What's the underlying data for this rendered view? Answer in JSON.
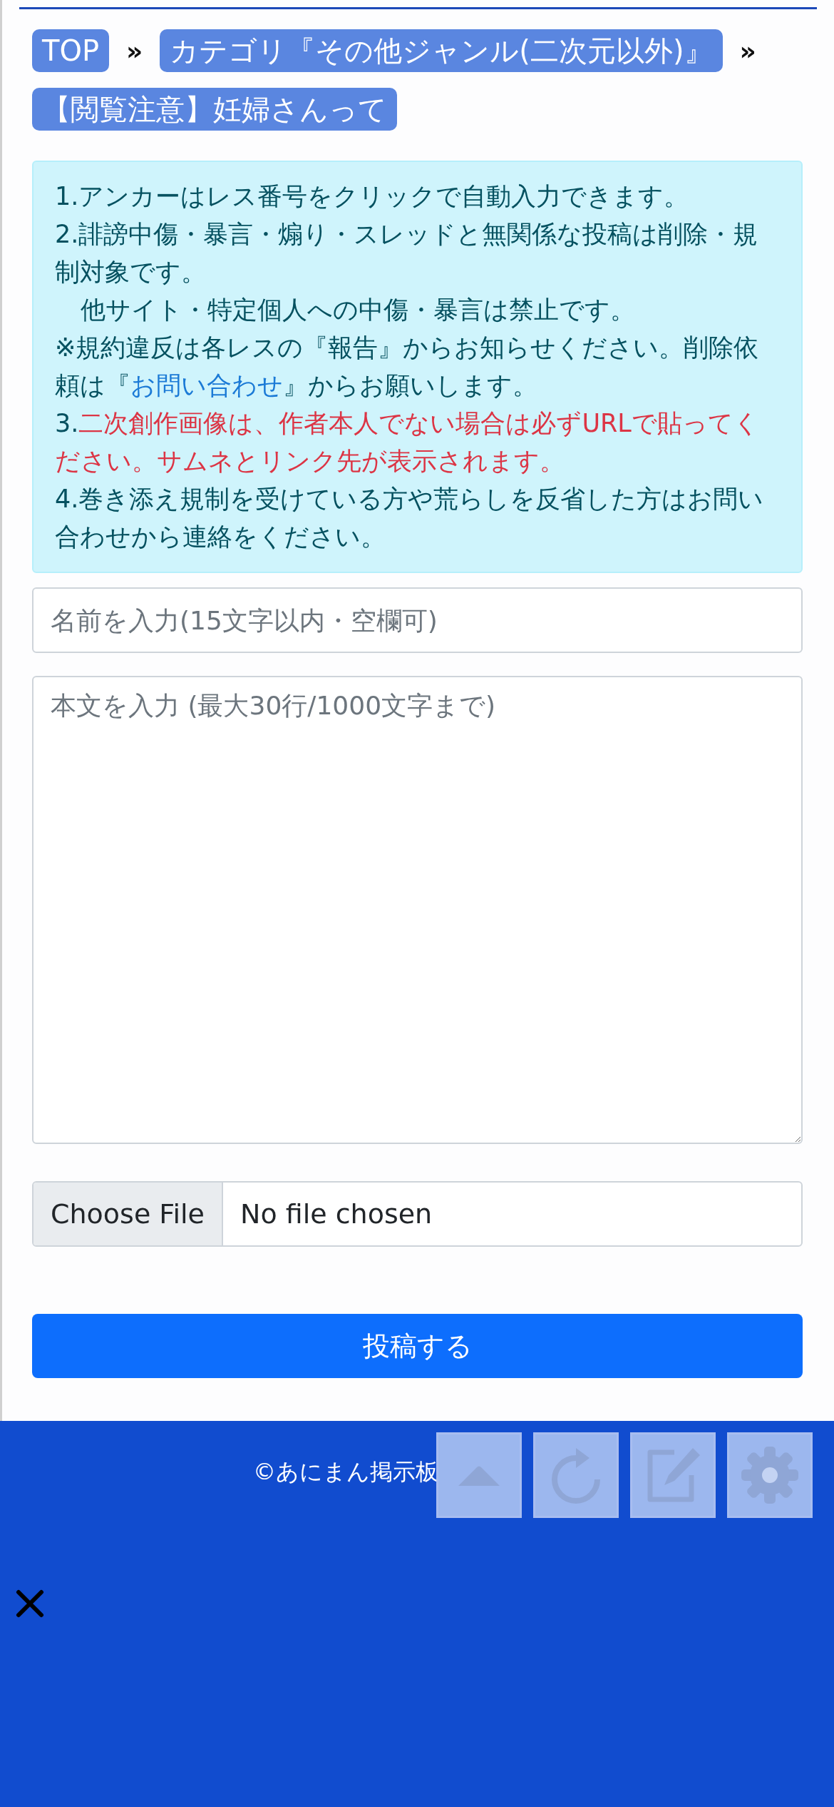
{
  "breadcrumbs": [
    {
      "kind": "link",
      "label": "TOP"
    },
    {
      "kind": "separator",
      "label": "»"
    },
    {
      "kind": "link",
      "label": "カテゴリ『その他ジャンル(二次元以外)』"
    },
    {
      "kind": "separator",
      "label": "»"
    },
    {
      "kind": "link",
      "label": "【閲覧注意】妊婦さんって"
    }
  ],
  "notice": [
    {
      "indent": false,
      "segments": [
        {
          "kind": "plain",
          "text": "1.アンカーはレス番号をクリックで自動入力できます。"
        }
      ]
    },
    {
      "indent": false,
      "segments": [
        {
          "kind": "plain",
          "text": "2.誹謗中傷・暴言・煽り・スレッドと無関係な投稿は削除・規制対象です。"
        }
      ]
    },
    {
      "indent": true,
      "segments": [
        {
          "kind": "plain",
          "text": "他サイト・特定個人への中傷・暴言は禁止です。"
        }
      ]
    },
    {
      "indent": false,
      "segments": [
        {
          "kind": "plain",
          "text": "※規約違反は各レスの『報告』からお知らせください。削除依頼は『"
        },
        {
          "kind": "link",
          "text": "お問い合わせ"
        },
        {
          "kind": "plain",
          "text": "』からお願いします。"
        }
      ]
    },
    {
      "indent": false,
      "segments": [
        {
          "kind": "plain",
          "text": "3."
        },
        {
          "kind": "warning",
          "text": "二次創作画像は、作者本人でない場合は必ずURLで貼ってください。サムネとリンク先が表示されます。"
        }
      ]
    },
    {
      "indent": false,
      "segments": [
        {
          "kind": "plain",
          "text": "4.巻き添え規制を受けている方や荒らしを反省した方はお問い合わせから連絡をください。"
        }
      ]
    }
  ],
  "form": {
    "name_field": {
      "placeholder": "名前を入力(15文字以内・空欄可)"
    },
    "body_field": {
      "placeholder": "本文を入力 (最大30行/1000文字まで)"
    },
    "file_input": {
      "button": "Choose File",
      "status": "No file chosen"
    },
    "submit": "投稿する"
  },
  "footer": {
    "copyright": "©あにまん掲示板"
  }
}
